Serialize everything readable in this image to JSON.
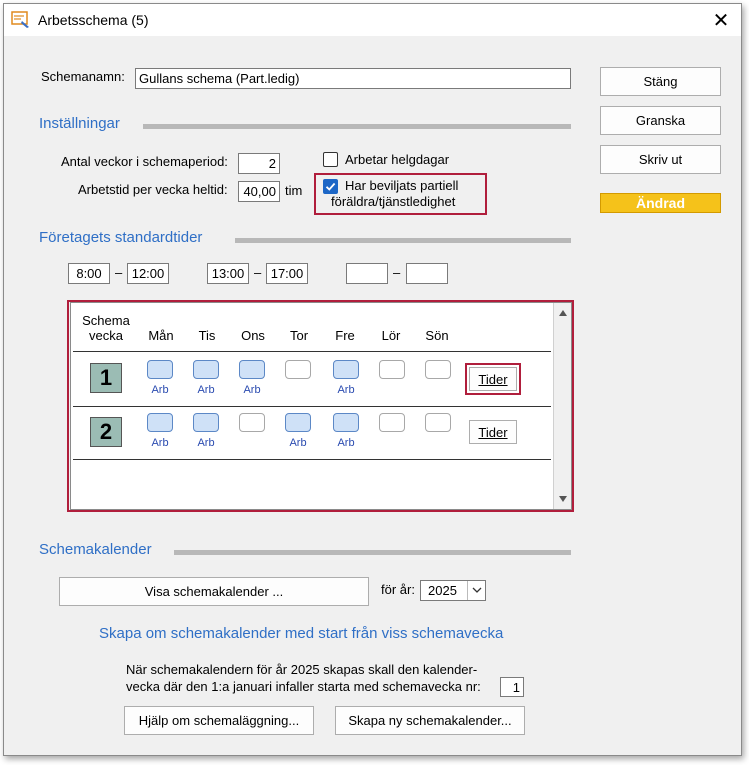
{
  "window": {
    "title": "Arbetsschema (5)"
  },
  "schemanamn": {
    "label": "Schemanamn:",
    "value": "Gullans schema (Part.ledig)"
  },
  "buttons": {
    "stang": "Stäng",
    "granska": "Granska",
    "skriv_ut": "Skriv ut",
    "andrad": "Ändrad"
  },
  "installningar": {
    "title": "Inställningar",
    "antal_veckor_label": "Antal veckor i schemaperiod:",
    "antal_veckor_value": "2",
    "arbetstid_label": "Arbetstid per vecka heltid:",
    "arbetstid_value": "40,00",
    "arbetstid_unit": "tim",
    "helgdagar_label": "Arbetar helgdagar",
    "helgdagar_checked": false,
    "foraldra_label_1": "Har beviljats partiell",
    "foraldra_label_2": "föräldra/tjänstledighet",
    "foraldra_checked": true
  },
  "standardtider": {
    "title": "Företagets standardtider",
    "pairs": [
      {
        "from": "8:00",
        "to": "12:00"
      },
      {
        "from": "13:00",
        "to": "17:00"
      },
      {
        "from": "",
        "to": ""
      }
    ],
    "dash": "–"
  },
  "schedule": {
    "header_schema": "Schema",
    "header_vecka": "vecka",
    "days": [
      "Mån",
      "Tis",
      "Ons",
      "Tor",
      "Fre",
      "Lör",
      "Sön"
    ],
    "weeks": [
      {
        "number": "1",
        "active": [
          true,
          true,
          true,
          false,
          true,
          false,
          false
        ],
        "label": "Arb"
      },
      {
        "number": "2",
        "active": [
          true,
          true,
          false,
          true,
          true,
          false,
          false
        ],
        "label": "Arb"
      }
    ],
    "tider_button": "Tider"
  },
  "schemakalender": {
    "title": "Schemakalender",
    "visa_button": "Visa schemakalender ...",
    "for_ar_label": "för år:",
    "year": "2025",
    "skapa_om_title": "Skapa om schemakalender med start från viss schemavecka",
    "info_line1": "När schemakalendern för år 2025 skapas skall den kalender-",
    "info_line2": "vecka där den 1:a januari infaller starta med schemavecka nr:",
    "start_week": "1",
    "hjalp_button": "Hjälp om schemaläggning...",
    "skapa_ny_button": "Skapa ny schemakalender..."
  },
  "colors": {
    "accent_blue": "#2f6fc6",
    "badge_yellow": "#f5c21a",
    "highlight_red": "#b01e3c",
    "day_active": "#cfe1f7",
    "week_badge": "#9bbcb4"
  }
}
